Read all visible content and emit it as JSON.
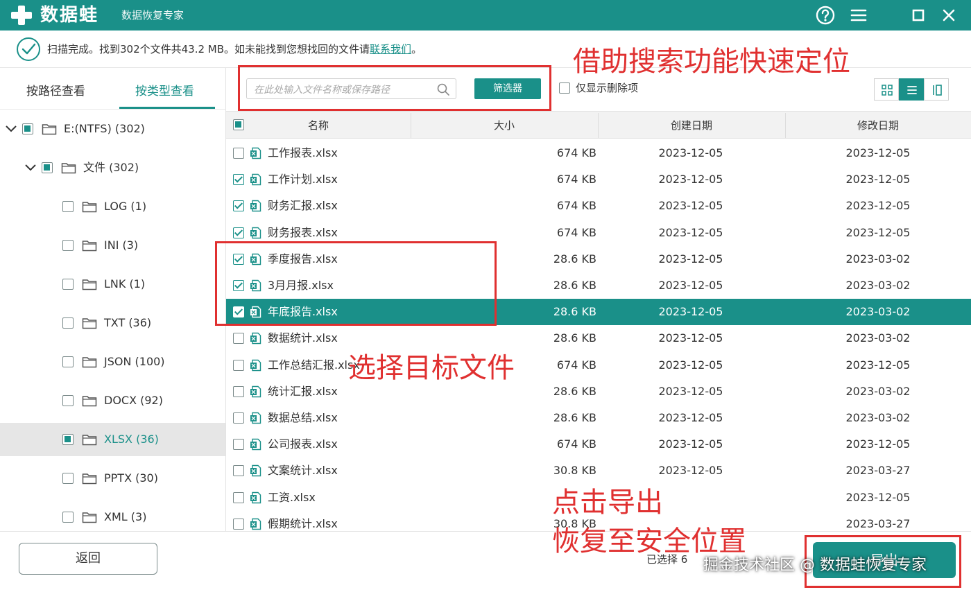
{
  "app": {
    "name": "数据蛙",
    "subtitle": "数据恢复专家"
  },
  "status": {
    "message": "扫描完成。找到302个文件共43.2 MB。如未能找到您想找回的文件请",
    "link": "联系我们",
    "suffix": "。"
  },
  "view_tabs": {
    "by_path": "按路径查看",
    "by_type": "按类型查看",
    "active": "by_type"
  },
  "tree": [
    {
      "label": "E:(NTFS) (302)",
      "level": 0,
      "expanded": true,
      "check": "partial"
    },
    {
      "label": "文件 (302)",
      "level": 1,
      "expanded": true,
      "check": "partial"
    },
    {
      "label": "LOG (1)",
      "level": 2,
      "check": "none"
    },
    {
      "label": "INI (3)",
      "level": 2,
      "check": "none"
    },
    {
      "label": "LNK (1)",
      "level": 2,
      "check": "none"
    },
    {
      "label": "TXT (36)",
      "level": 2,
      "check": "none"
    },
    {
      "label": "JSON (100)",
      "level": 2,
      "check": "none"
    },
    {
      "label": "DOCX (92)",
      "level": 2,
      "check": "none"
    },
    {
      "label": "XLSX (36)",
      "level": 2,
      "check": "partial",
      "selected": true
    },
    {
      "label": "PPTX (30)",
      "level": 2,
      "check": "none"
    },
    {
      "label": "XML (3)",
      "level": 2,
      "check": "none"
    }
  ],
  "toolbar": {
    "search_placeholder": "在此处输入文件名称或保存路径",
    "filter_label": "筛选器",
    "only_deleted_label": "仅显示删除项"
  },
  "table": {
    "columns": [
      "名称",
      "大小",
      "创建日期",
      "修改日期"
    ],
    "rows": [
      {
        "name": "工作报表.xlsx",
        "size": "674 KB",
        "created": "2023-12-05",
        "modified": "2023-12-05",
        "checked": false
      },
      {
        "name": "工作计划.xlsx",
        "size": "674 KB",
        "created": "2023-12-05",
        "modified": "2023-12-05",
        "checked": true
      },
      {
        "name": "财务汇报.xlsx",
        "size": "674 KB",
        "created": "2023-12-05",
        "modified": "2023-12-05",
        "checked": true
      },
      {
        "name": "财务报表.xlsx",
        "size": "674 KB",
        "created": "2023-12-05",
        "modified": "2023-12-05",
        "checked": true
      },
      {
        "name": "季度报告.xlsx",
        "size": "28.6 KB",
        "created": "2023-12-05",
        "modified": "2023-03-02",
        "checked": true
      },
      {
        "name": "3月月报.xlsx",
        "size": "28.6 KB",
        "created": "2023-12-05",
        "modified": "2023-03-02",
        "checked": true
      },
      {
        "name": "年底报告.xlsx",
        "size": "28.6 KB",
        "created": "2023-12-05",
        "modified": "2023-03-02",
        "checked": true,
        "selected": true
      },
      {
        "name": "数据统计.xlsx",
        "size": "28.6 KB",
        "created": "2023-12-05",
        "modified": "2023-03-02",
        "checked": false
      },
      {
        "name": "工作总结汇报.xlsx",
        "size": "674 KB",
        "created": "2023-12-05",
        "modified": "2023-12-05",
        "checked": false
      },
      {
        "name": "统计汇报.xlsx",
        "size": "28.6 KB",
        "created": "2023-12-05",
        "modified": "2023-03-02",
        "checked": false
      },
      {
        "name": "数据总结.xlsx",
        "size": "28.6 KB",
        "created": "2023-12-05",
        "modified": "2023-03-02",
        "checked": false
      },
      {
        "name": "公司报表.xlsx",
        "size": "674 KB",
        "created": "2023-12-05",
        "modified": "2023-12-05",
        "checked": false
      },
      {
        "name": "文案统计.xlsx",
        "size": "30.8 KB",
        "created": "2023-12-05",
        "modified": "2023-03-27",
        "checked": false
      },
      {
        "name": "工资.xlsx",
        "size": "",
        "created": "",
        "modified": "2023-12-05",
        "checked": false
      },
      {
        "name": "假期统计.xlsx",
        "size": "30.8 KB",
        "created": "",
        "modified": "2023-03-27",
        "checked": false
      }
    ]
  },
  "bottom": {
    "back_label": "返回",
    "selected_text": "已选择 6",
    "export_label": "导出"
  },
  "annotations": {
    "search_hint": "借助搜索功能快速定位",
    "select_hint": "选择目标文件",
    "export_hint_line1": "点击导出",
    "export_hint_line2": "恢复至安全位置"
  },
  "watermark": "掘金技术社区 @ 数据蛙恢复专家",
  "colors": {
    "primary": "#1a9089",
    "annotation": "#e03030"
  }
}
